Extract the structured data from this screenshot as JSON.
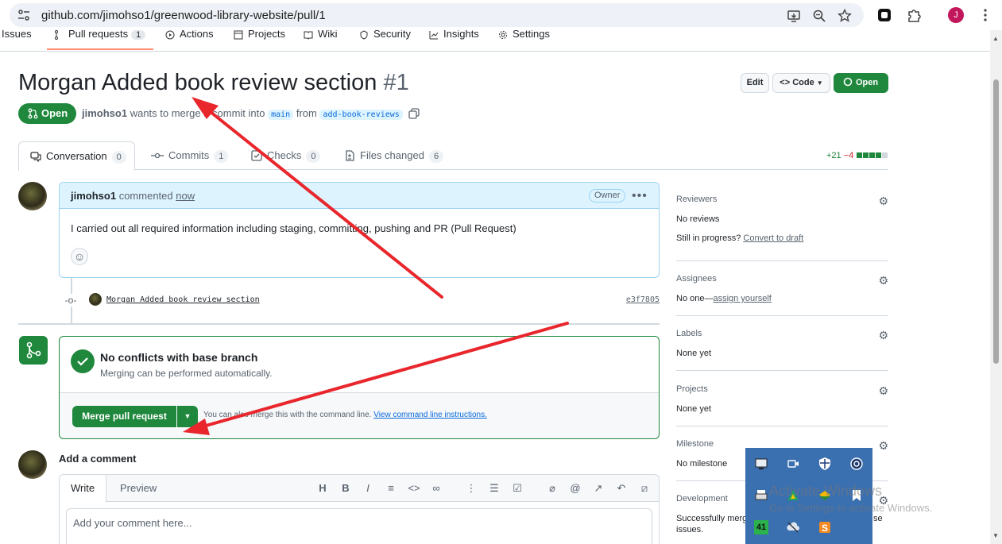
{
  "browser": {
    "url": "github.com/jimohso1/greenwood-library-website/pull/1",
    "profile_initial": "J",
    "icons": [
      "site-info-icon",
      "install-app-icon",
      "zoom-icon",
      "bookmark-star-icon",
      "extension-icon",
      "puzzle-icon",
      "profile-avatar",
      "more-vert-icon"
    ]
  },
  "repo_nav": {
    "items": [
      {
        "label": "Issues"
      },
      {
        "label": "Pull requests",
        "count": "1"
      },
      {
        "label": "Actions"
      },
      {
        "label": "Projects"
      },
      {
        "label": "Wiki"
      },
      {
        "label": "Security"
      },
      {
        "label": "Insights"
      },
      {
        "label": "Settings"
      }
    ]
  },
  "pr": {
    "title": "Morgan Added book review section",
    "number": "#1",
    "edit_label": "Edit",
    "code_label": "Code",
    "open_button_label": "Open",
    "state_label": "Open",
    "author": "jimohso1",
    "meta_text_1": "wants to merge 1 commit into",
    "base_branch": "main",
    "meta_from": "from",
    "head_branch": "add-book-reviews"
  },
  "tabs": [
    {
      "label": "Conversation",
      "count": "0"
    },
    {
      "label": "Commits",
      "count": "1"
    },
    {
      "label": "Checks",
      "count": "0"
    },
    {
      "label": "Files changed",
      "count": "6"
    }
  ],
  "diffstat": {
    "additions": "+21",
    "deletions": "−4"
  },
  "comment": {
    "author": "jimohso1",
    "action": "commented",
    "time": "now",
    "role_badge": "Owner",
    "body": "I carried out all required information including staging, committing, pushing and PR (Pull Request)"
  },
  "commit": {
    "message": "Morgan Added book review section",
    "sha": "e3f7805"
  },
  "merge": {
    "title": "No conflicts with base branch",
    "subtitle": "Merging can be performed automatically.",
    "button_label": "Merge pull request",
    "hint_text": "You can also merge this with the command line.",
    "hint_link": "View command line instructions."
  },
  "add_comment": {
    "title": "Add a comment",
    "write_tab": "Write",
    "preview_tab": "Preview",
    "placeholder": "Add your comment here..."
  },
  "sidebar": {
    "reviewers": {
      "label": "Reviewers",
      "value": "No reviews",
      "progress_text": "Still in progress?",
      "progress_link": "Convert to draft"
    },
    "assignees": {
      "label": "Assignees",
      "value": "No one—",
      "link": "assign yourself"
    },
    "labels": {
      "label": "Labels",
      "value": "None yet"
    },
    "projects": {
      "label": "Projects",
      "value": "None yet"
    },
    "milestone": {
      "label": "Milestone",
      "value": "No milestone"
    },
    "development": {
      "label": "Development",
      "value_line1": "Successfully merg",
      "value_line1_tail": "se",
      "value_line2": "issues."
    }
  },
  "tray": {
    "badge_number": "41"
  },
  "watermark": {
    "line1": "Activate Windows",
    "line2": "Go to Settings to activate Windows."
  },
  "colors": {
    "accent_green": "#1f883d",
    "link_blue": "#0969da",
    "annotation_red": "#e8262c",
    "tray_blue": "#3a6fb0"
  }
}
